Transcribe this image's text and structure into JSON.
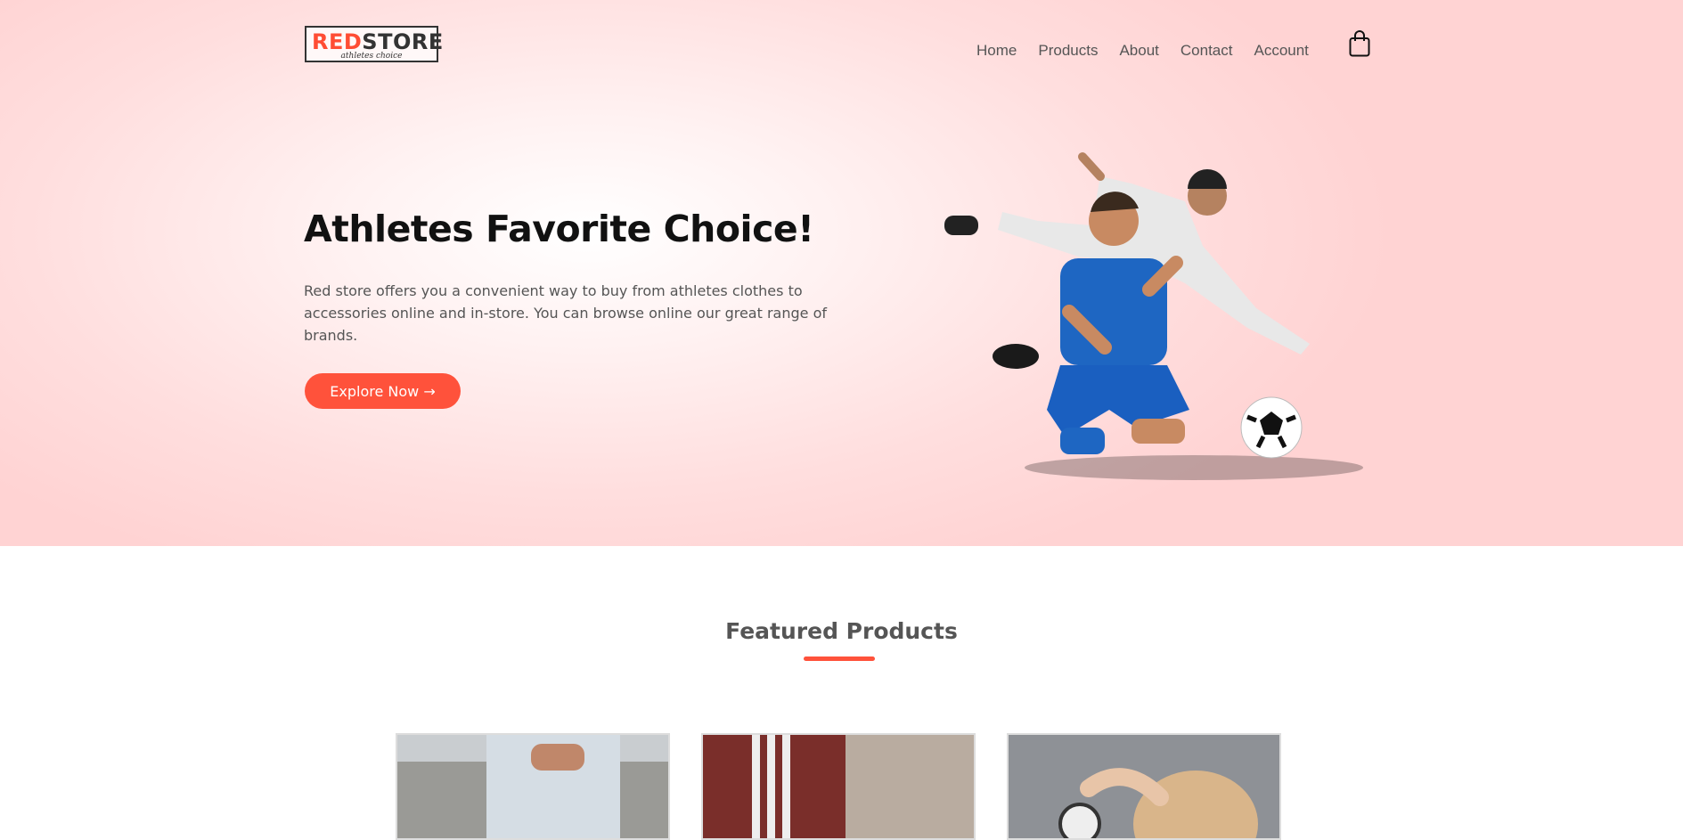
{
  "brand": {
    "logo_red": "RED",
    "logo_dark": "STORE",
    "tagline": "athletes choice",
    "accent": "#ff523b"
  },
  "nav": {
    "items": [
      "Home",
      "Products",
      "About",
      "Contact",
      "Account"
    ]
  },
  "hero": {
    "title": "Athletes Favorite Choice!",
    "description": "Red store offers you a convenient way to buy from athletes clothes to accessories online and in-store. You can browse online our great range of brands.",
    "cta": "Explore Now →"
  },
  "featured": {
    "title": "Featured Products"
  },
  "icons": {
    "cart": "shopping-bag-icon"
  }
}
